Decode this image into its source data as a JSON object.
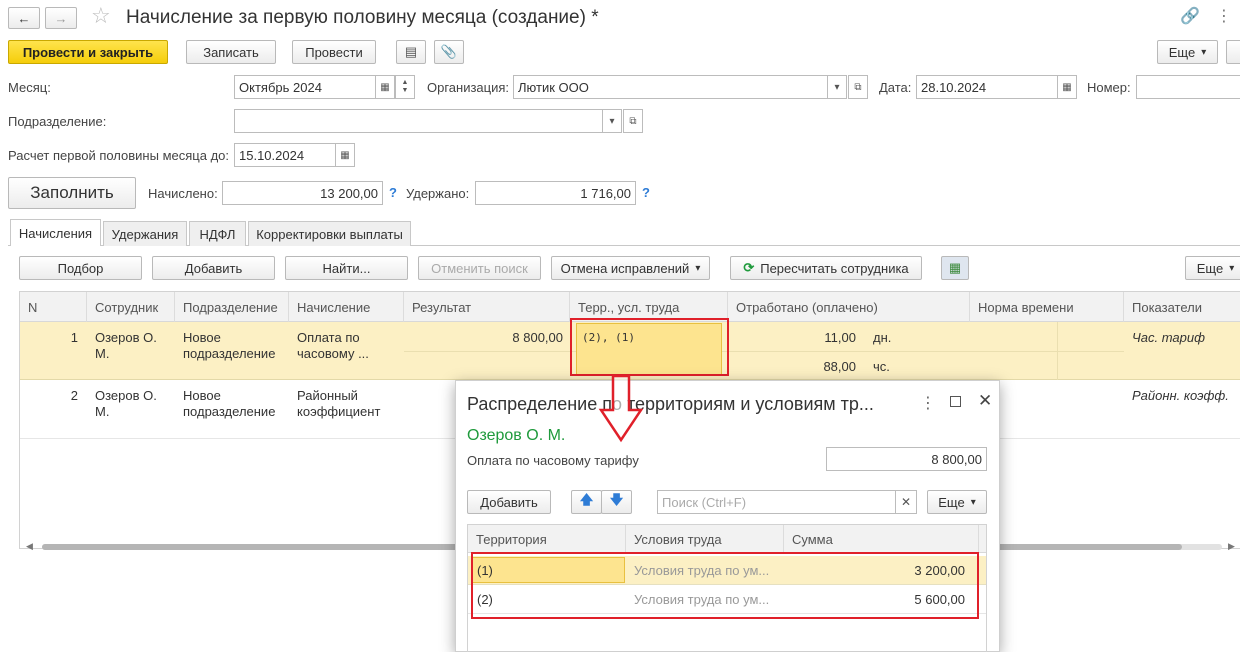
{
  "window": {
    "title": "Начисление за первую половину месяца (создание) *"
  },
  "toolbar": {
    "post_close": "Провести и закрыть",
    "save": "Записать",
    "post": "Провести",
    "more": "Еще"
  },
  "form": {
    "month_label": "Месяц:",
    "month_value": "Октябрь 2024",
    "org_label": "Организация:",
    "org_value": "Лютик ООО",
    "date_label": "Дата:",
    "date_value": "28.10.2024",
    "number_label": "Номер:",
    "dept_label": "Подразделение:",
    "calc_label": "Расчет первой половины месяца до:",
    "calc_value": "15.10.2024",
    "fill_button": "Заполнить",
    "accrued_label": "Начислено:",
    "accrued_value": "13 200,00",
    "withheld_label": "Удержано:",
    "withheld_value": "1 716,00",
    "help_mark": "?"
  },
  "tabs": [
    {
      "label": "Начисления"
    },
    {
      "label": "Удержания"
    },
    {
      "label": "НДФЛ"
    },
    {
      "label": "Корректировки выплаты"
    }
  ],
  "table_toolbar": {
    "pick": "Подбор",
    "add": "Добавить",
    "find": "Найти...",
    "cancel_search": "Отменить поиск",
    "cancel_fixes": "Отмена исправлений",
    "recalc": "Пересчитать сотрудника",
    "more": "Еще"
  },
  "table": {
    "headers": [
      "N",
      "Сотрудник",
      "Подразделение",
      "Начисление",
      "Результат",
      "Терр., усл. труда",
      "Отработано (оплачено)",
      "Норма времени",
      "Показатели"
    ],
    "rows": [
      {
        "n": "1",
        "employee": "Озеров О. М.",
        "dept": "Новое подразделение",
        "accrual": "Оплата по часовому ...",
        "result": "8 800,00",
        "terr": "(2), (1)",
        "worked_days": "11,00",
        "unit_days": "дн.",
        "worked_hours": "88,00",
        "unit_hours": "чс.",
        "indicator": "Час. тариф"
      },
      {
        "n": "2",
        "employee": "Озеров О. М.",
        "dept": "Новое подразделение",
        "accrual": "Районный коэффициент",
        "indicator": "Районн. коэфф."
      }
    ]
  },
  "popup": {
    "title": "Распределение по территориям и условиям тр...",
    "employee": "Озеров О. М.",
    "accrual_label": "Оплата по часовому тарифу",
    "accrual_value": "8 800,00",
    "add": "Добавить",
    "search_placeholder": "Поиск (Ctrl+F)",
    "more": "Еще",
    "headers": [
      "Территория",
      "Условия труда",
      "Сумма"
    ],
    "rows": [
      {
        "territory": "(1)",
        "conditions": "Условия труда по ум...",
        "sum": "3 200,00"
      },
      {
        "territory": "(2)",
        "conditions": "Условия труда по ум...",
        "sum": "5 600,00"
      }
    ]
  },
  "colors": {
    "accent_yellow": "#f5cd0a",
    "row_highlight": "#fcf0c4",
    "employee_green": "#1f9a3c",
    "annotation_red": "#e0202a",
    "help_blue": "#2e7cd6"
  }
}
